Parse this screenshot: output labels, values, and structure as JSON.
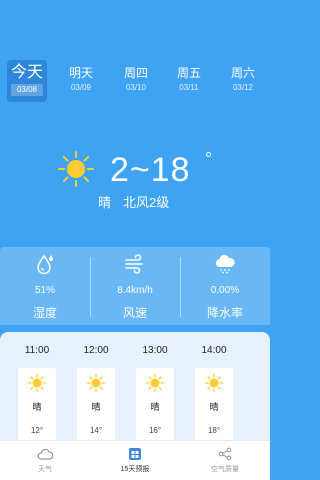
{
  "days": [
    {
      "name": "今天",
      "date": "03/08",
      "active": true
    },
    {
      "name": "明天",
      "date": "03/09"
    },
    {
      "name": "周四",
      "date": "03/10"
    },
    {
      "name": "周五",
      "date": "03/11"
    },
    {
      "name": "周六",
      "date": "03/12"
    }
  ],
  "current": {
    "temp_range": "2~18",
    "degree_symbol": "°",
    "condition": "晴",
    "wind": "北风2级",
    "icon": "sun-icon"
  },
  "stats": [
    {
      "value": "51%",
      "label": "湿度",
      "icon": "humidity-icon"
    },
    {
      "value": "8.4km/h",
      "label": "风速",
      "icon": "wind-icon"
    },
    {
      "value": "0.00%",
      "label": "降水率",
      "icon": "rain-cloud-icon"
    }
  ],
  "hourly": [
    {
      "time": "11:00",
      "condition": "晴",
      "temp": "12°"
    },
    {
      "time": "12:00",
      "condition": "晴",
      "temp": "14°"
    },
    {
      "time": "13:00",
      "condition": "晴",
      "temp": "16°"
    },
    {
      "time": "14:00",
      "condition": "晴",
      "temp": "18°"
    }
  ],
  "nav": [
    {
      "label": "天气",
      "icon": "cloud-icon"
    },
    {
      "label": "15天预报",
      "icon": "calendar-icon",
      "active": true
    },
    {
      "label": "空气质量",
      "icon": "share-icon"
    }
  ],
  "colors": {
    "background": "#3fa3f4",
    "stats_panel": "#6ab7f5",
    "sun": "#ffcc33",
    "active_nav": "#3f8ae0"
  }
}
